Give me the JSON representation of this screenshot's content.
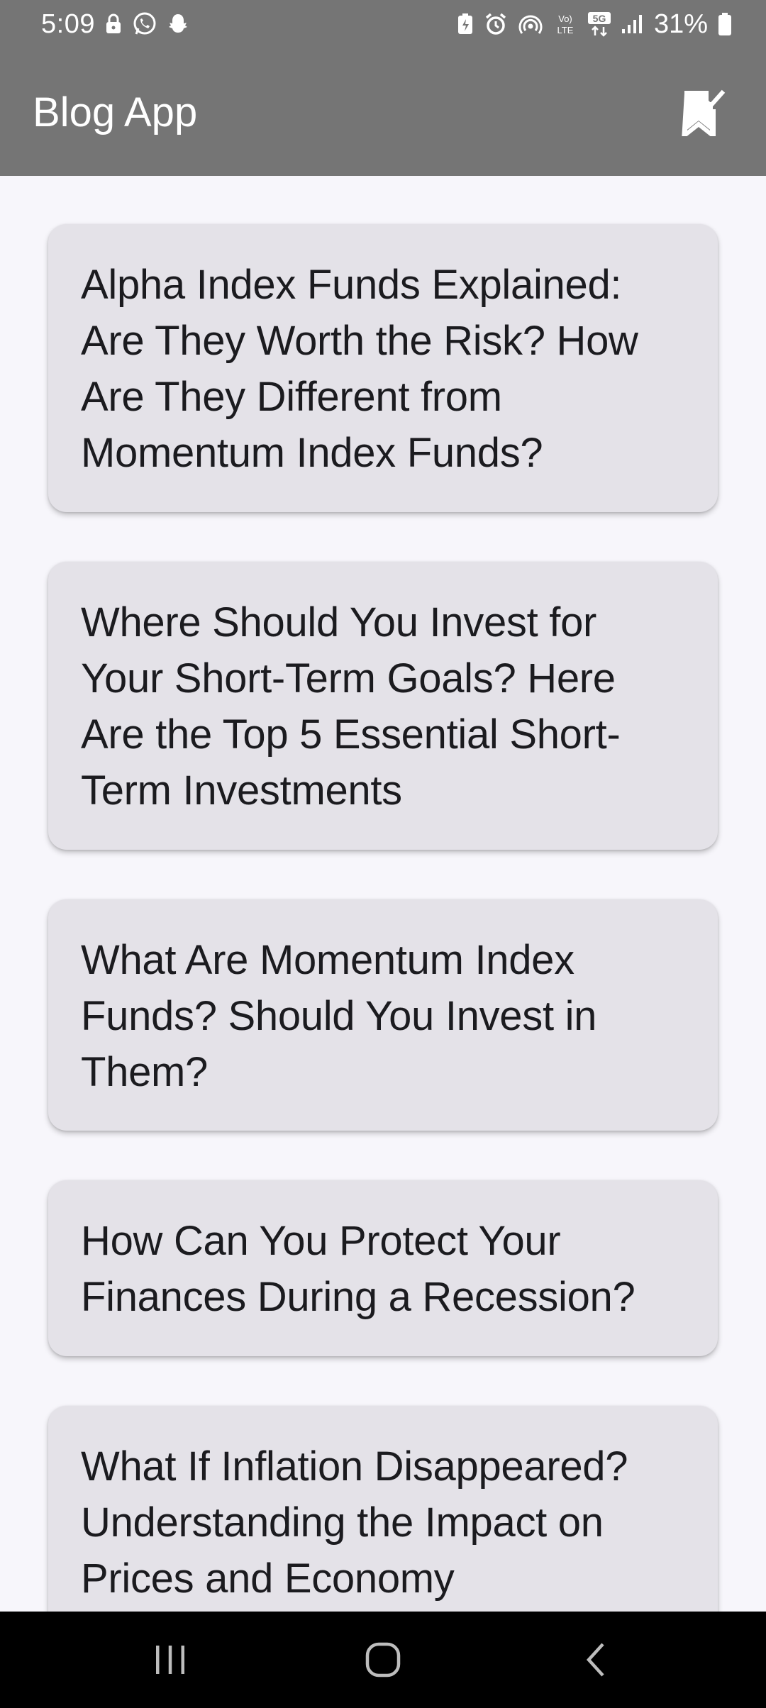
{
  "status_bar": {
    "time": "5:09",
    "battery_percent": "31%",
    "left_icons": [
      "lock-icon",
      "whatsapp-icon",
      "snapchat-icon"
    ],
    "right_icons": [
      "battery-saver-icon",
      "alarm-icon",
      "hotspot-icon",
      "volte-icon",
      "5g-icon",
      "signal-icon",
      "battery-icon"
    ],
    "volte_label": "Vo) LTE",
    "network_label": "5G"
  },
  "app_bar": {
    "title": "Blog App",
    "action_icon": "bookmark-check-icon",
    "background": "#757575"
  },
  "posts": [
    {
      "title": "Alpha Index Funds Explained: Are They Worth the Risk? How Are They Different from Momentum Index Funds?"
    },
    {
      "title": "Where Should You Invest for Your Short-Term Goals? Here Are the Top 5 Essential Short-Term Investments"
    },
    {
      "title": "What Are Momentum Index Funds? Should You Invest in Them?"
    },
    {
      "title": "How Can You Protect Your Finances During a Recession?"
    },
    {
      "title": "What If Inflation Disappeared? Understanding the Impact on Prices and Economy"
    }
  ],
  "nav_bar": {
    "buttons": [
      "recents-icon",
      "home-icon",
      "back-icon"
    ]
  },
  "colors": {
    "app_bar": "#757575",
    "page_background": "#f7f6fb",
    "card_background": "#e4e2e8",
    "card_text": "#1b1b1f",
    "nav_bar": "#000000"
  }
}
